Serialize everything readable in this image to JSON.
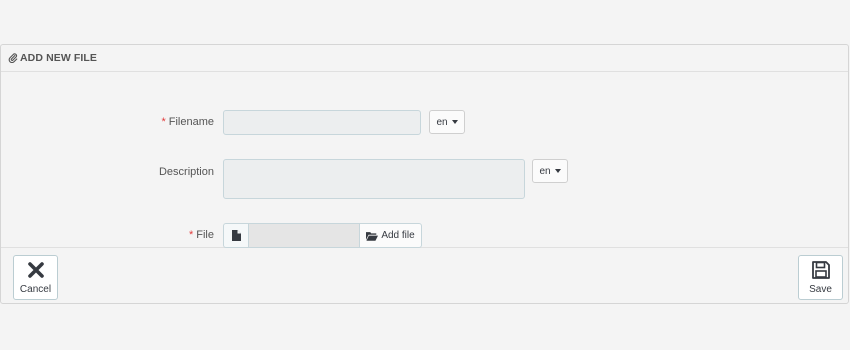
{
  "panel": {
    "title": "ADD NEW FILE",
    "title_icon": "paperclip-icon"
  },
  "form": {
    "filename": {
      "label": "Filename",
      "required_mark": "*",
      "value": "",
      "lang": "en"
    },
    "description": {
      "label": "Description",
      "value": "",
      "lang": "en"
    },
    "file": {
      "label": "File",
      "required_mark": "*",
      "file_icon": "file-icon",
      "value": "",
      "add_label": "Add file",
      "add_icon": "folder-open-icon"
    }
  },
  "footer": {
    "cancel_label": "Cancel",
    "cancel_icon": "close-icon",
    "save_label": "Save",
    "save_icon": "floppy-disk-icon"
  },
  "colors": {
    "required": "#e23b3b",
    "input_bg": "#eceeef",
    "input_border": "#c7d6db",
    "page_bg": "#f4f4f4"
  }
}
